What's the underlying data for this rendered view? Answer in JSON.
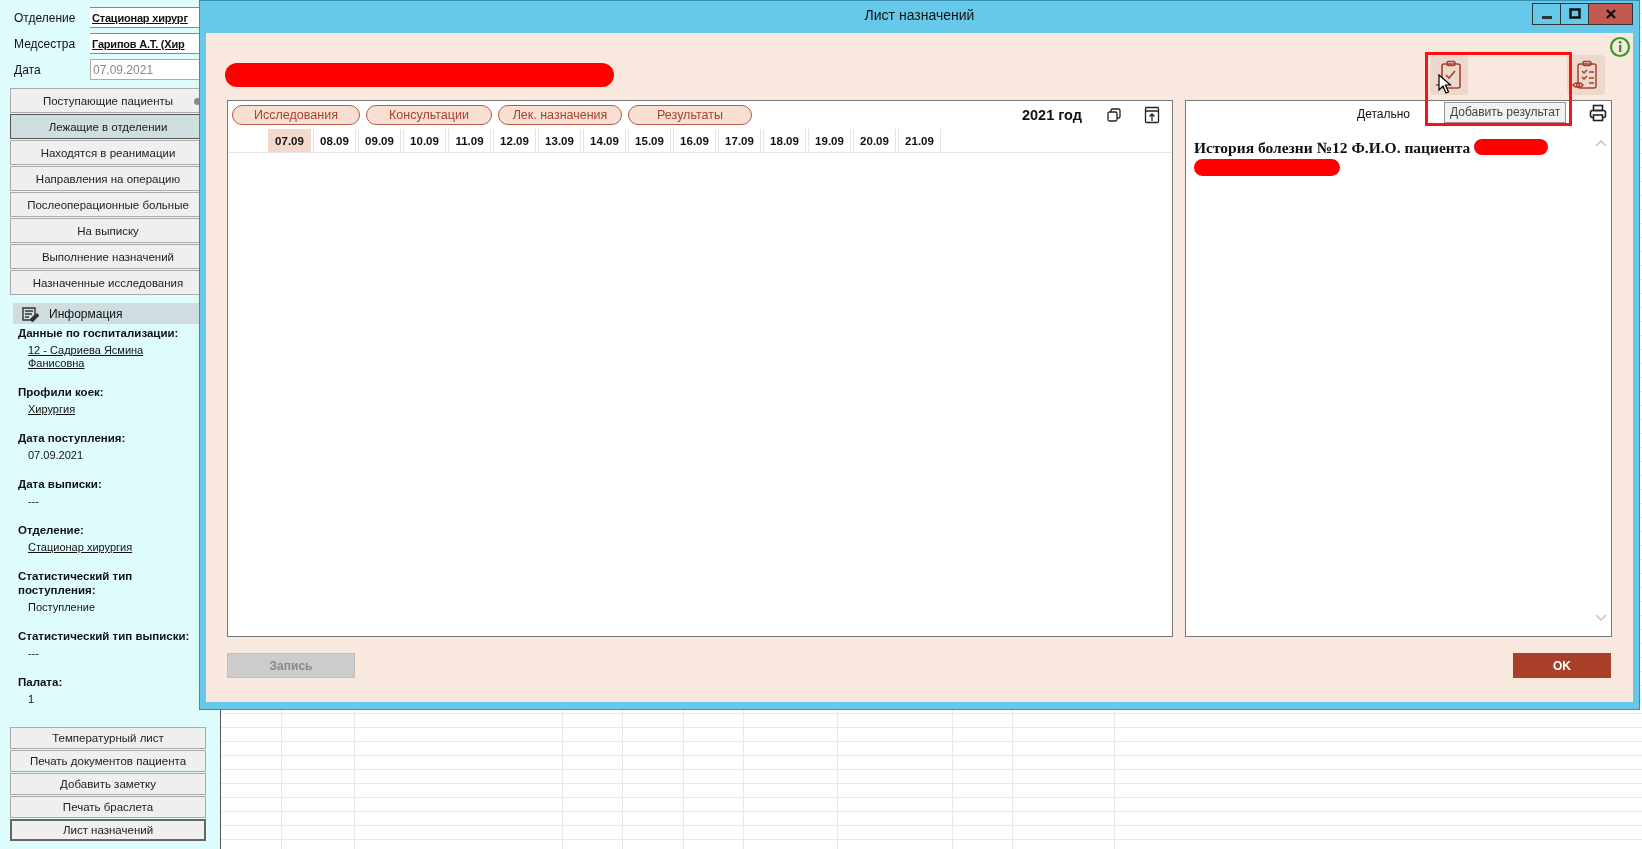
{
  "sidebar": {
    "fields": [
      {
        "label": "Отделение",
        "value": "Стационар  хирург",
        "kind": "link"
      },
      {
        "label": "Медсестра",
        "value": "Гарипов А.Т. (Хир",
        "kind": "link"
      },
      {
        "label": "Дата",
        "value": "07.09.2021",
        "kind": "input"
      }
    ],
    "nav": [
      {
        "label": "Поступающие пациенты",
        "selected": false
      },
      {
        "label": "Лежащие в отделении",
        "selected": true
      },
      {
        "label": "Находятся в реанимации",
        "selected": false
      },
      {
        "label": "Направления на операцию",
        "selected": false
      },
      {
        "label": "Послеоперационные больные",
        "selected": false
      },
      {
        "label": "На выписку",
        "selected": false
      },
      {
        "label": "Выполнение назначений",
        "selected": false
      },
      {
        "label": "Назначенные исследования",
        "selected": false
      }
    ],
    "info": {
      "title": "Информация",
      "items": [
        {
          "label": "Данные по госпитализации:",
          "value": "12 - Садриева Ясмина Фанисовна",
          "kind": "link"
        },
        {
          "label": "Профили коек:",
          "value": "Хирургия",
          "kind": "link"
        },
        {
          "label": "Дата поступления:",
          "value": "07.09.2021",
          "kind": "text"
        },
        {
          "label": "Дата выписки:",
          "value": "---",
          "kind": "text"
        },
        {
          "label": "Отделение:",
          "value": "Стационар  хирургия",
          "kind": "link"
        },
        {
          "label": "Статистический тип поступления:",
          "value": "Поступление",
          "kind": "text"
        },
        {
          "label": "Статистический тип выписки:",
          "value": "---",
          "kind": "text"
        },
        {
          "label": "Палата:",
          "value": "1",
          "kind": "text"
        }
      ]
    },
    "actions": [
      {
        "label": "Температурный лист",
        "selected": false
      },
      {
        "label": "Печать документов пациента",
        "selected": false
      },
      {
        "label": "Добавить заметку",
        "selected": false
      },
      {
        "label": "Печать браслета",
        "selected": false
      },
      {
        "label": "Лист назначений",
        "selected": true
      }
    ]
  },
  "dialog": {
    "title": "Лист назначений",
    "tabs": [
      "Исследования",
      "Консультации",
      "Лек. назначения",
      "Результаты"
    ],
    "year": "2021 год",
    "dates": [
      {
        "label": "07.09",
        "selected": true
      },
      {
        "label": "08.09",
        "selected": false
      },
      {
        "label": "09.09",
        "selected": false
      },
      {
        "label": "10.09",
        "selected": false
      },
      {
        "label": "11.09",
        "selected": false
      },
      {
        "label": "12.09",
        "selected": false
      },
      {
        "label": "13.09",
        "selected": false
      },
      {
        "label": "14.09",
        "selected": false
      },
      {
        "label": "15.09",
        "selected": false
      },
      {
        "label": "16.09",
        "selected": false
      },
      {
        "label": "17.09",
        "selected": false
      },
      {
        "label": "18.09",
        "selected": false
      },
      {
        "label": "19.09",
        "selected": false
      },
      {
        "label": "20.09",
        "selected": false
      },
      {
        "label": "21.09",
        "selected": false
      }
    ],
    "detail": {
      "title": "Детально",
      "heading": "История болезни №12 Ф.И.О. пациента"
    },
    "tooltip": "Добавить результат",
    "buttons": [
      {
        "label": "Запись",
        "disabled": true
      },
      {
        "label": "OK",
        "disabled": false
      }
    ]
  }
}
